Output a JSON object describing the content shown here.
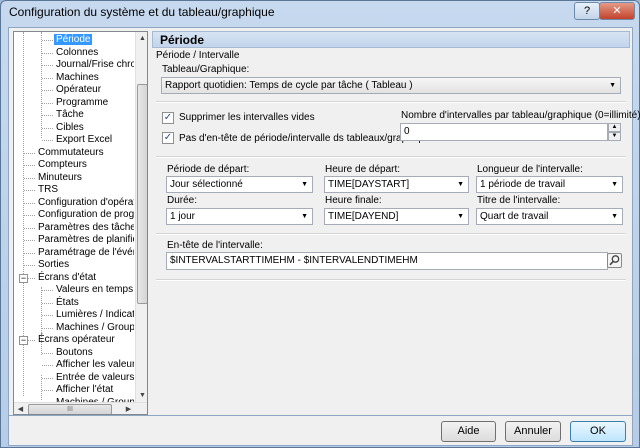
{
  "window": {
    "title": "Configuration du système et du tableau/graphique",
    "help_label": "?",
    "close_label": "✕"
  },
  "tree": {
    "items": [
      {
        "label": "Période",
        "selected": true
      },
      {
        "label": "Colonnes"
      },
      {
        "label": "Journal/Frise chronol"
      },
      {
        "label": "Machines"
      },
      {
        "label": "Opérateur"
      },
      {
        "label": "Programme"
      },
      {
        "label": "Tâche"
      },
      {
        "label": "Cibles"
      },
      {
        "label": "Export Excel"
      },
      {
        "label": "Commutateurs"
      },
      {
        "label": "Compteurs"
      },
      {
        "label": "Minuteurs"
      },
      {
        "label": "TRS"
      },
      {
        "label": "Configuration d'opérateur"
      },
      {
        "label": "Configuration de programm"
      },
      {
        "label": "Paramètres des tâches"
      },
      {
        "label": "Paramètres de planificatio"
      },
      {
        "label": "Paramétrage de l'événeme"
      },
      {
        "label": "Sorties"
      },
      {
        "label": "Écrans d'état"
      },
      {
        "label": "Valeurs en temps réel"
      },
      {
        "label": "États"
      },
      {
        "label": "Lumières / Indicateur"
      },
      {
        "label": "Machines / Groupes"
      },
      {
        "label": "Écrans opérateur"
      },
      {
        "label": "Boutons"
      },
      {
        "label": "Afficher les valeurs"
      },
      {
        "label": "Entrée de valeurs"
      },
      {
        "label": "Afficher l'état"
      },
      {
        "label": "Machines / Groupes"
      }
    ],
    "expander_minus": "−",
    "scroll_up": "▲",
    "scroll_down": "▼",
    "scroll_left": "◀",
    "scroll_right": "▶",
    "hthumb_grip": "III"
  },
  "panel": {
    "header": "Période",
    "group_label": "Période / Intervalle",
    "table_label": "Tableau/Graphique:",
    "table_value": "Rapport quotidien: Temps de cycle par tâche  ( Tableau )",
    "suppress_label": "Supprimer les intervalles vides",
    "suppress_checked": true,
    "no_header_label": "Pas d'en-tête de période/intervalle ds tableaux/graphique",
    "no_header_checked": true,
    "count_label": "Nombre d'intervalles par tableau/graphique (0=illimité):",
    "count_value": "0",
    "start_period_label": "Période de départ:",
    "start_period_value": "Jour sélectionné",
    "start_time_label": "Heure de départ:",
    "start_time_value": "TIME[DAYSTART]",
    "length_label": "Longueur de l'intervalle:",
    "length_value": "1 période de travail",
    "duration_label": "Durée:",
    "duration_value": "1 jour",
    "end_time_label": "Heure finale:",
    "end_time_value": "TIME[DAYEND]",
    "title_label": "Titre de l'intervalle:",
    "title_value": "Quart de travail",
    "interval_header_label": "En-tête de l'intervalle:",
    "interval_header_value": "$INTERVALSTARTTIMEHM - $INTERVALENDTIMEHM",
    "check_mark": "✓",
    "dropdown_arrow": "▼",
    "spin_up": "▲",
    "spin_down": "▼"
  },
  "buttons": {
    "help": "Aide",
    "cancel": "Annuler",
    "ok": "OK"
  },
  "colors": {
    "selection": "#3399ff",
    "header_bg": "#c2d5ec"
  }
}
